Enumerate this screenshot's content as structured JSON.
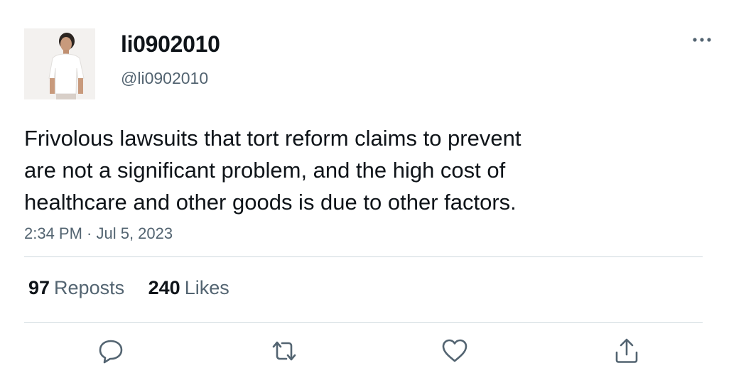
{
  "user": {
    "display_name": "li0902010",
    "handle": "@li0902010"
  },
  "tweet": {
    "text_lines": [
      "Frivolous lawsuits that tort reform claims to prevent",
      "are not a significant problem, and the high cost of",
      "healthcare and other goods is due to other factors."
    ],
    "timestamp": "2:34 PM · Jul 5, 2023"
  },
  "stats": {
    "reposts_count": "97",
    "reposts_label": "Reposts",
    "likes_count": "240",
    "likes_label": "Likes"
  },
  "icons": {
    "more": "more-horizontal-icon",
    "reply": "reply-icon",
    "repost": "repost-icon",
    "like": "heart-icon",
    "share": "share-icon"
  },
  "colors": {
    "text_primary": "#0f1419",
    "text_secondary": "#536471",
    "divider": "#cfd9de"
  }
}
